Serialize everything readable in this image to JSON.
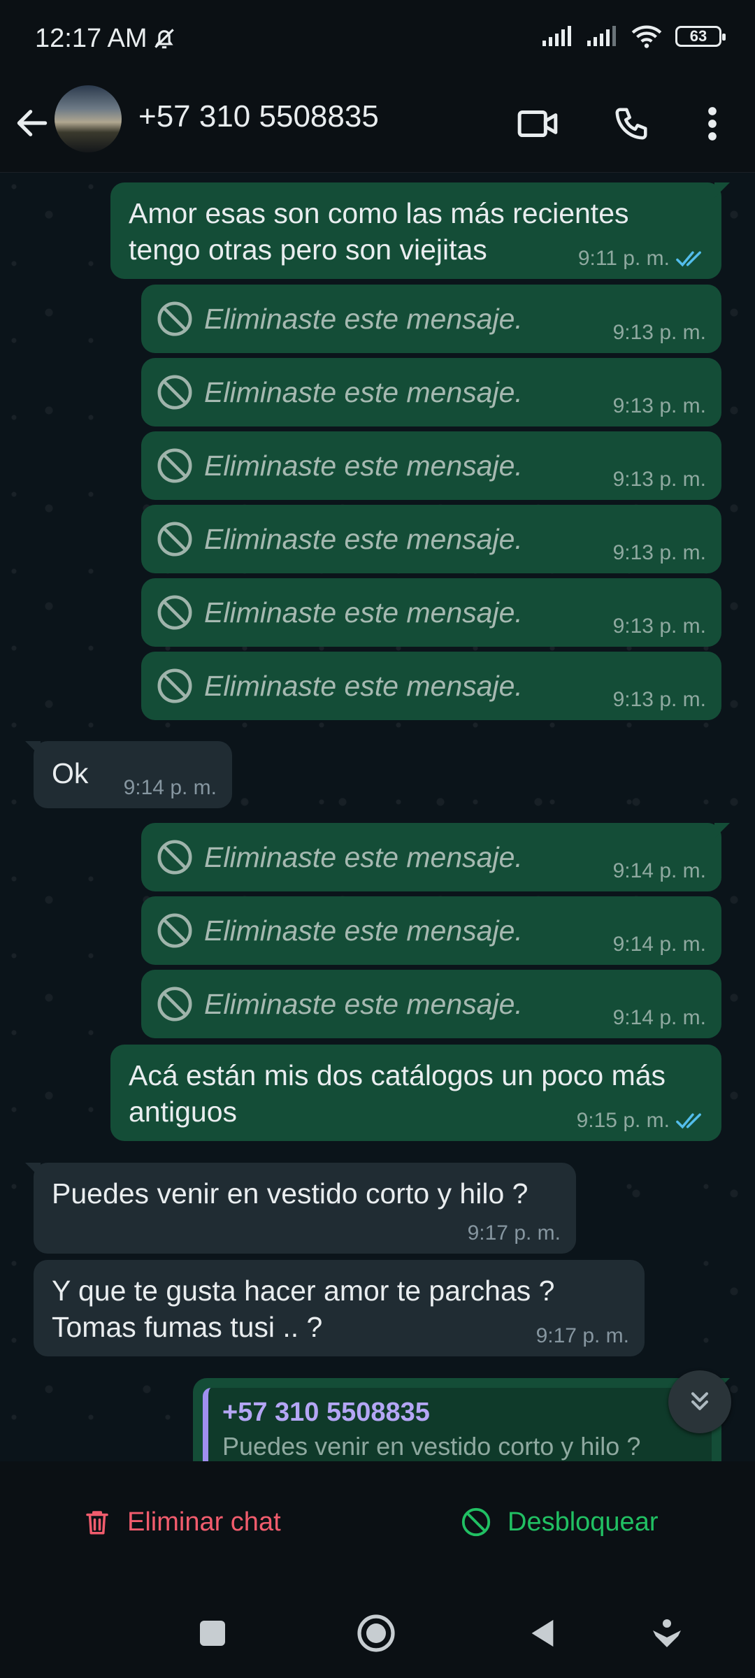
{
  "status_bar": {
    "time": "12:17 AM",
    "battery": "63"
  },
  "header": {
    "contact": "+57 310 5508835"
  },
  "messages": [
    {
      "type": "out",
      "text": "Amor esas son como las más recientes tengo otras pero son viejitas",
      "time": "9:11 p. m."
    },
    {
      "type": "deleted",
      "text": "Eliminaste este mensaje.",
      "time": "9:13 p. m."
    },
    {
      "type": "deleted",
      "text": "Eliminaste este mensaje.",
      "time": "9:13 p. m."
    },
    {
      "type": "deleted",
      "text": "Eliminaste este mensaje.",
      "time": "9:13 p. m."
    },
    {
      "type": "deleted",
      "text": "Eliminaste este mensaje.",
      "time": "9:13 p. m."
    },
    {
      "type": "deleted",
      "text": "Eliminaste este mensaje.",
      "time": "9:13 p. m."
    },
    {
      "type": "deleted",
      "text": "Eliminaste este mensaje.",
      "time": "9:13 p. m."
    },
    {
      "type": "in",
      "text": "Ok",
      "time": "9:14 p. m."
    },
    {
      "type": "deleted",
      "text": "Eliminaste este mensaje.",
      "time": "9:14 p. m."
    },
    {
      "type": "deleted",
      "text": "Eliminaste este mensaje.",
      "time": "9:14 p. m."
    },
    {
      "type": "deleted",
      "text": "Eliminaste este mensaje.",
      "time": "9:14 p. m."
    },
    {
      "type": "out",
      "text": "Acá están mis dos catálogos un poco más antiguos",
      "time": "9:15 p. m."
    },
    {
      "type": "in",
      "text": "Puedes venir en vestido corto y hilo ?",
      "time": "9:17 p. m."
    },
    {
      "type": "in",
      "text": "Y que te gusta hacer amor te parchas ? Tomas fumas tusi .. ?",
      "time": "9:17 p. m."
    }
  ],
  "reply_preview": {
    "name": "+57 310 5508835",
    "text": "Puedes venir en vestido corto y hilo ?"
  },
  "block_bar": {
    "delete_label": "Eliminar chat",
    "unblock_label": "Desbloquear"
  },
  "colors": {
    "delete": "#f15c6d",
    "unblock": "#21c063",
    "read_ticks": "#53bdeb",
    "outgoing_bubble": "#144d37",
    "incoming_bubble": "#202c33"
  }
}
